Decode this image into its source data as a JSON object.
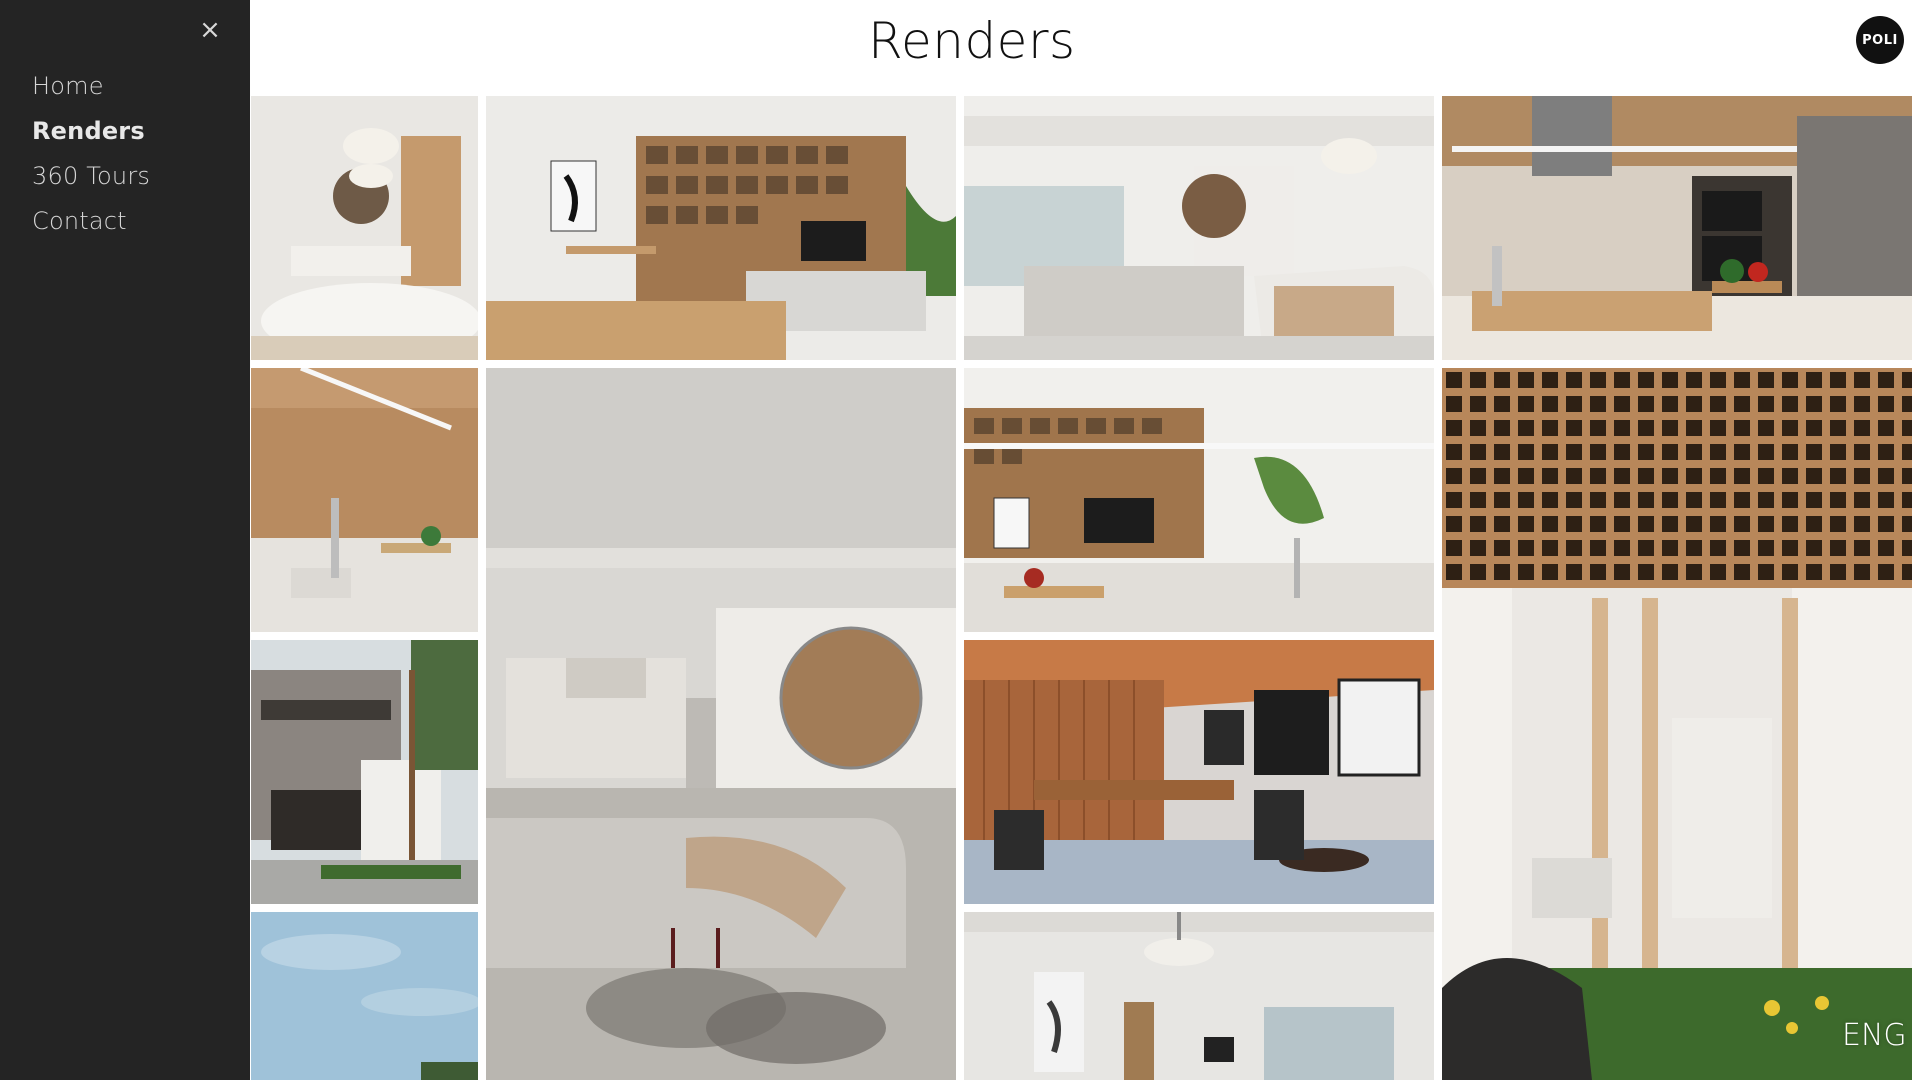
{
  "sidebar": {
    "close_label": "×",
    "items": [
      {
        "label": "Home"
      },
      {
        "label": "Renders",
        "active": true
      },
      {
        "label": "360 Tours"
      },
      {
        "label": "Contact"
      }
    ]
  },
  "header": {
    "title": "Renders",
    "logo_text": "POLI"
  },
  "language": "ENG",
  "colors": {
    "sidebar_bg": "#242424",
    "sidebar_text": "#d6d6d6",
    "title_text": "#111111",
    "page_bg": "#ffffff"
  }
}
